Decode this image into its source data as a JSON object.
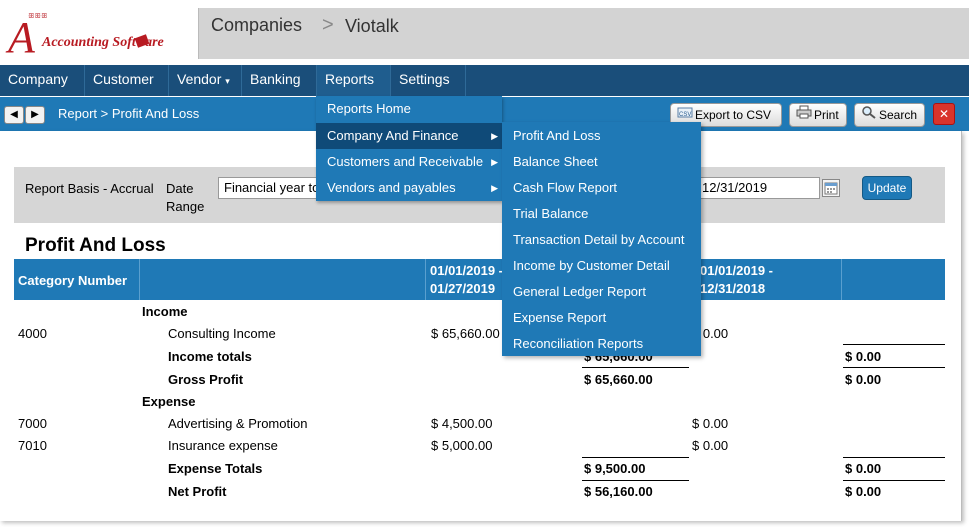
{
  "app": {
    "logo_text": "Accounting Software",
    "breadcrumb": {
      "root": "Companies",
      "separator": ">",
      "company": "Viotalk"
    }
  },
  "menubar": {
    "items": [
      "Company",
      "Customer",
      "Vendor",
      "Banking",
      "Reports",
      "Settings"
    ],
    "caret": "▾"
  },
  "subbar": {
    "back": "◀",
    "forward": "▶",
    "title": "Report > Profit And Loss",
    "export_label": "Export to CSV",
    "print_label": "Print",
    "search_label": "Search",
    "close_label": "✕"
  },
  "filters": {
    "basis_label": "Report Basis - Accrual",
    "date_label": "Date",
    "range_label": "Range",
    "range_value": "Financial year to date",
    "to_date_value": "12/31/2019",
    "update_label": "Update"
  },
  "report": {
    "title": "Profit And Loss",
    "columns": {
      "category": "Category Number",
      "period1_line1": "01/01/2019 -",
      "period1_line2": "01/27/2019",
      "period2_line1": "01/01/2019 -",
      "period2_line2": "12/31/2018"
    },
    "income_heading": "Income",
    "income_rows": [
      {
        "number": "4000",
        "name": "Consulting Income",
        "p1": "$ 65,660.00",
        "p2": "$ 0.00"
      }
    ],
    "income_totals": {
      "label": "Income totals",
      "total": "$ 65,660.00",
      "p2_total": "$ 0.00"
    },
    "gross_profit": {
      "label": "Gross Profit",
      "total": "$ 65,660.00",
      "p2_total": "$ 0.00"
    },
    "expense_heading": "Expense",
    "expense_rows": [
      {
        "number": "7000",
        "name": "Advertising & Promotion",
        "p1": "$ 4,500.00",
        "p2": "$ 0.00"
      },
      {
        "number": "7010",
        "name": "Insurance expense",
        "p1": "$ 5,000.00",
        "p2": "$ 0.00"
      }
    ],
    "expense_totals": {
      "label": "Expense Totals",
      "total": "$ 9,500.00",
      "p2_total": "$ 0.00"
    },
    "net_profit": {
      "label": "Net Profit",
      "total": "$ 56,160.00",
      "p2_total": "$ 0.00"
    }
  },
  "reports_menu": {
    "items": [
      "Reports Home",
      "Company And Finance",
      "Customers and Receivable",
      "Vendors and payables"
    ],
    "submenu_arrow": "▶"
  },
  "company_finance_menu": {
    "items": [
      "Profit And Loss",
      "Balance Sheet",
      "Cash Flow Report",
      "Trial Balance",
      "Transaction Detail by Account",
      "Income by Customer Detail",
      "General Ledger Report",
      "Expense Report",
      "Reconciliation Reports"
    ]
  },
  "colors": {
    "menubar": "#1a4e7a",
    "accent": "#1f79b6",
    "active_menu_item": "#0f4a78",
    "logo_red": "#b81b22"
  }
}
